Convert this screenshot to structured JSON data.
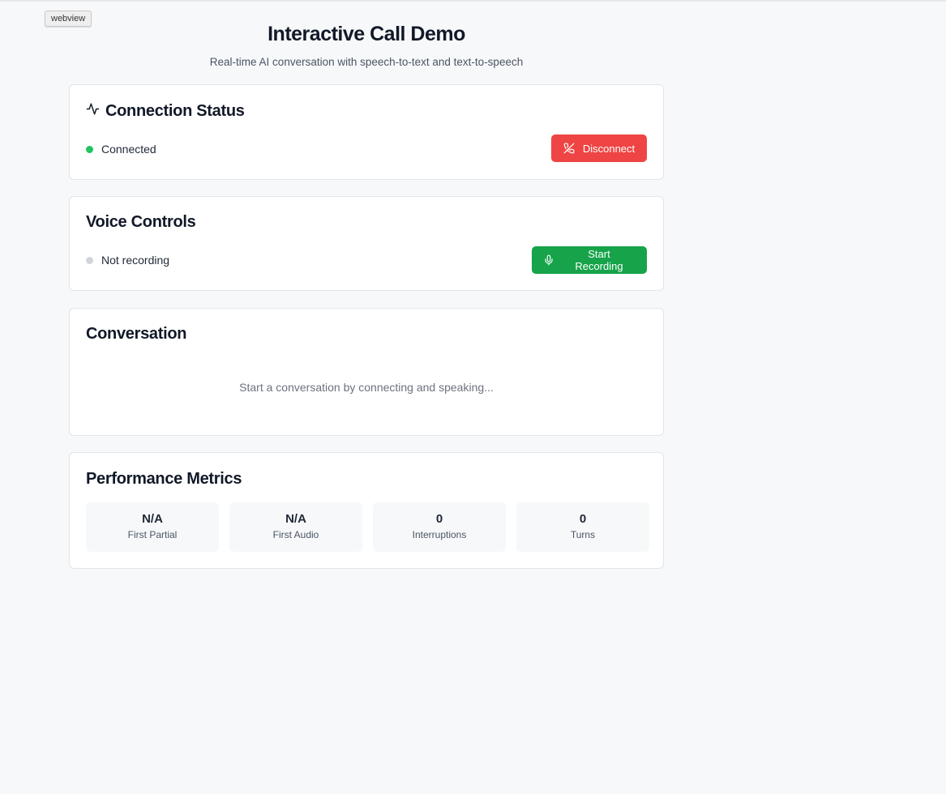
{
  "webview_tag": "webview",
  "header": {
    "title": "Interactive Call Demo",
    "subtitle": "Real-time AI conversation with speech-to-text and text-to-speech"
  },
  "connection": {
    "title": "Connection Status",
    "icon": "activity-icon",
    "status_text": "Connected",
    "status_color": "#22c55e",
    "button_label": "Disconnect",
    "button_icon": "phone-off-icon",
    "button_color": "#ef4444"
  },
  "voice": {
    "title": "Voice Controls",
    "status_text": "Not recording",
    "status_color": "#d1d5db",
    "button_label": "Start Recording",
    "button_icon": "microphone-icon",
    "button_color": "#16a34a"
  },
  "conversation": {
    "title": "Conversation",
    "placeholder": "Start a conversation by connecting and speaking..."
  },
  "metrics": {
    "title": "Performance Metrics",
    "items": [
      {
        "value": "N/A",
        "label": "First Partial"
      },
      {
        "value": "N/A",
        "label": "First Audio"
      },
      {
        "value": "0",
        "label": "Interruptions"
      },
      {
        "value": "0",
        "label": "Turns"
      }
    ]
  }
}
